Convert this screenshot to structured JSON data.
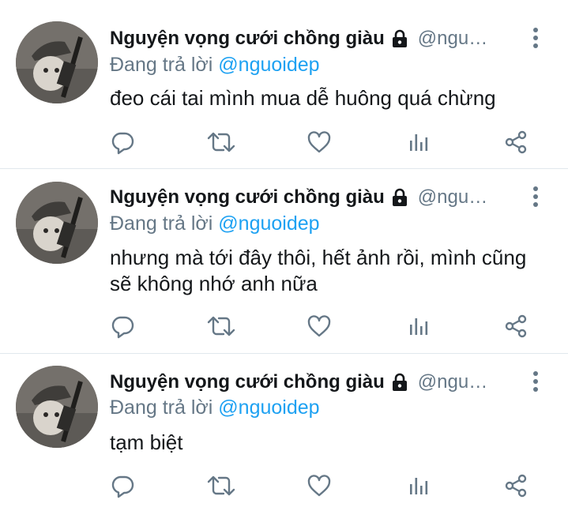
{
  "tweets": [
    {
      "display_name": "Nguyện vọng cưới chồng giàu",
      "handle": "@ngu…",
      "reply_prefix": "Đang trả lời",
      "reply_to": "@nguoidep",
      "text": "đeo cái tai mình mua dễ huông quá chừng"
    },
    {
      "display_name": "Nguyện vọng cưới chồng giàu",
      "handle": "@ngu…",
      "reply_prefix": "Đang trả lời",
      "reply_to": "@nguoidep",
      "text": "nhưng mà tới đây thôi, hết ảnh rồi, mình cũng sẽ không nhớ anh nữa"
    },
    {
      "display_name": "Nguyện vọng cưới chồng giàu",
      "handle": "@ngu…",
      "reply_prefix": "Đang trả lời",
      "reply_to": "@nguoidep",
      "text": "tạm biệt"
    }
  ],
  "icons": {
    "protected": "lock-icon",
    "more": "more-vertical-icon",
    "reply": "reply-bubble-icon",
    "retweet": "retweet-icon",
    "like": "heart-icon",
    "analytics": "bar-chart-icon",
    "share": "share-icon"
  },
  "colors": {
    "text": "#14171a",
    "muted": "#657786",
    "link": "#1da1f2",
    "divider": "#e1e8ed",
    "icon": "#657786"
  }
}
